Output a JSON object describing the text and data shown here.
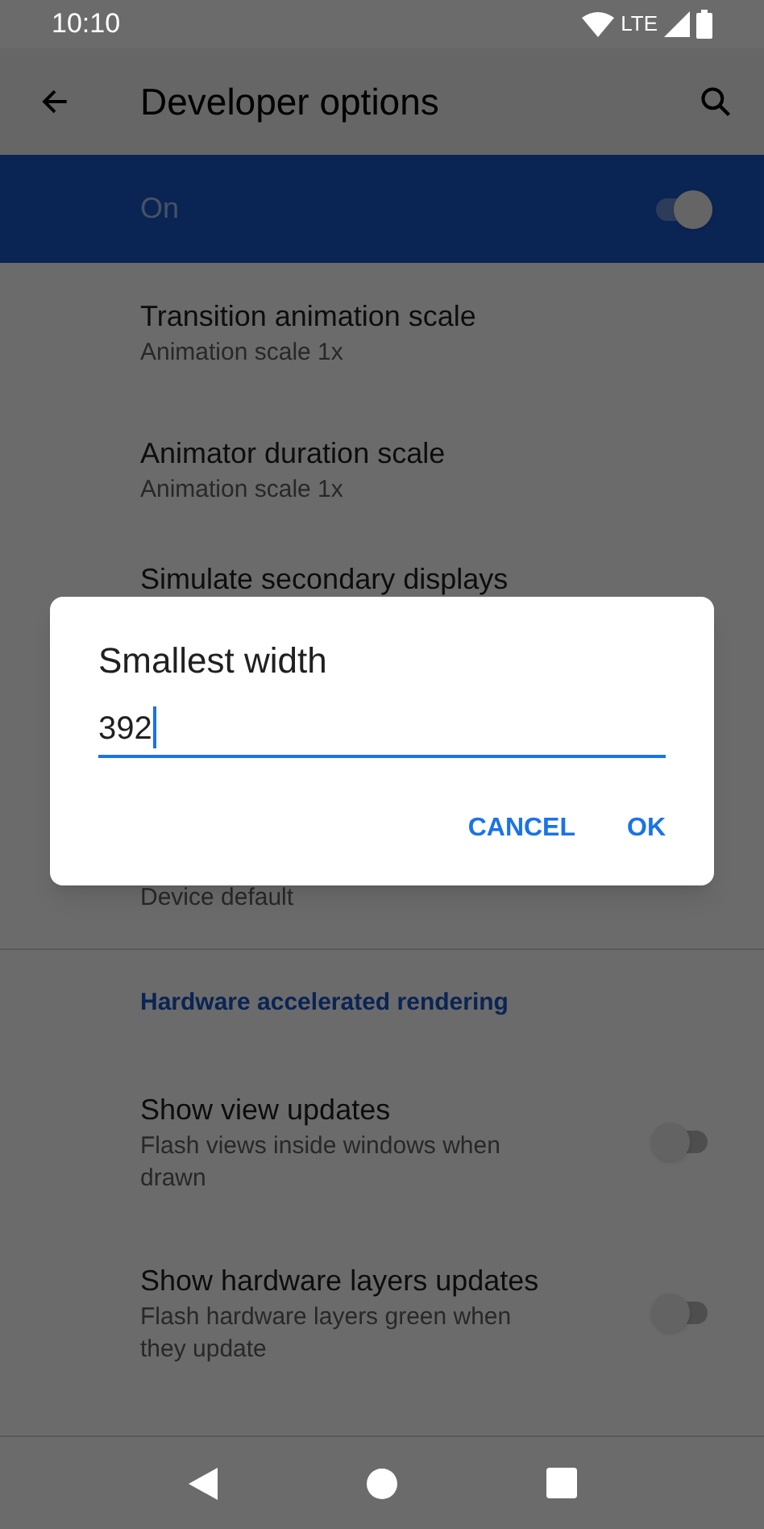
{
  "status_bar": {
    "time": "10:10",
    "network": "LTE"
  },
  "app_bar": {
    "title": "Developer options"
  },
  "main_switch": {
    "label": "On",
    "on": true
  },
  "items": [
    {
      "kind": "setting",
      "title": "Transition animation scale",
      "summary": "Animation scale 1x"
    },
    {
      "kind": "setting",
      "title": "Animator duration scale",
      "summary": "Animation scale 1x"
    },
    {
      "kind": "setting",
      "title": "Simulate secondary displays"
    },
    {
      "kind": "setting",
      "summary": "Device default"
    },
    {
      "kind": "header",
      "title": "Hardware accelerated rendering"
    },
    {
      "kind": "toggle",
      "title": "Show view updates",
      "summary": "Flash views inside windows when drawn",
      "on": false
    },
    {
      "kind": "toggle",
      "title": "Show hardware layers updates",
      "summary": "Flash hardware layers green when they update",
      "on": false
    }
  ],
  "dialog": {
    "title": "Smallest width",
    "value": "392",
    "buttons": [
      "CANCEL",
      "OK"
    ]
  }
}
